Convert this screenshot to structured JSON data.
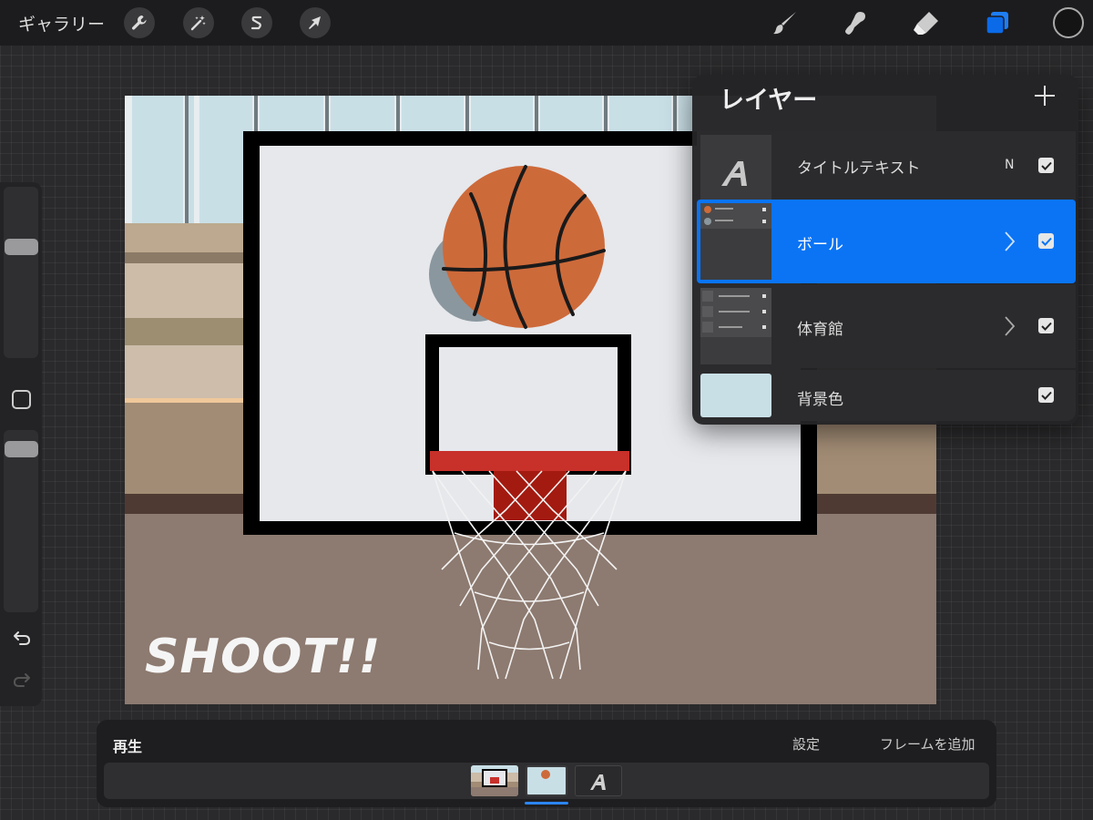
{
  "topbar": {
    "gallery_label": "ギャラリー",
    "tools_left": [
      "wrench-icon",
      "magic-wand-icon",
      "selection-s-icon",
      "transform-arrow-icon"
    ],
    "tools_right": [
      "brush-icon",
      "smudge-icon",
      "eraser-icon",
      "layers-icon"
    ],
    "active_color": "#141414",
    "accent": "#0a74f5"
  },
  "sidebar": {
    "controls": [
      "brush-size-slider",
      "modify-square-button",
      "opacity-slider",
      "undo-icon",
      "redo-icon"
    ]
  },
  "canvas": {
    "caption": "SHOOT!!",
    "colors": {
      "ball": "#cd6a3a",
      "floor": "#8d7a70",
      "backboard": "#e6e8ec",
      "rim": "#c8302a"
    }
  },
  "layers": {
    "title": "レイヤー",
    "add_icon": "plus-icon",
    "items": [
      {
        "name": "タイトルテキスト",
        "mode": "N",
        "visible": true,
        "selected": false
      },
      {
        "name": "ボール",
        "mode": "",
        "visible": true,
        "selected": true,
        "group": true
      },
      {
        "name": "体育館",
        "mode": "",
        "visible": true,
        "selected": false,
        "group": true
      },
      {
        "name": "背景色",
        "mode": "",
        "visible": true,
        "selected": false
      }
    ]
  },
  "bottombar": {
    "play_label": "再生",
    "settings_label": "設定",
    "add_frame_label": "フレームを追加",
    "frames": [
      "gym-frame",
      "ball-frame",
      "title-frame"
    ],
    "active_frame": 2
  }
}
